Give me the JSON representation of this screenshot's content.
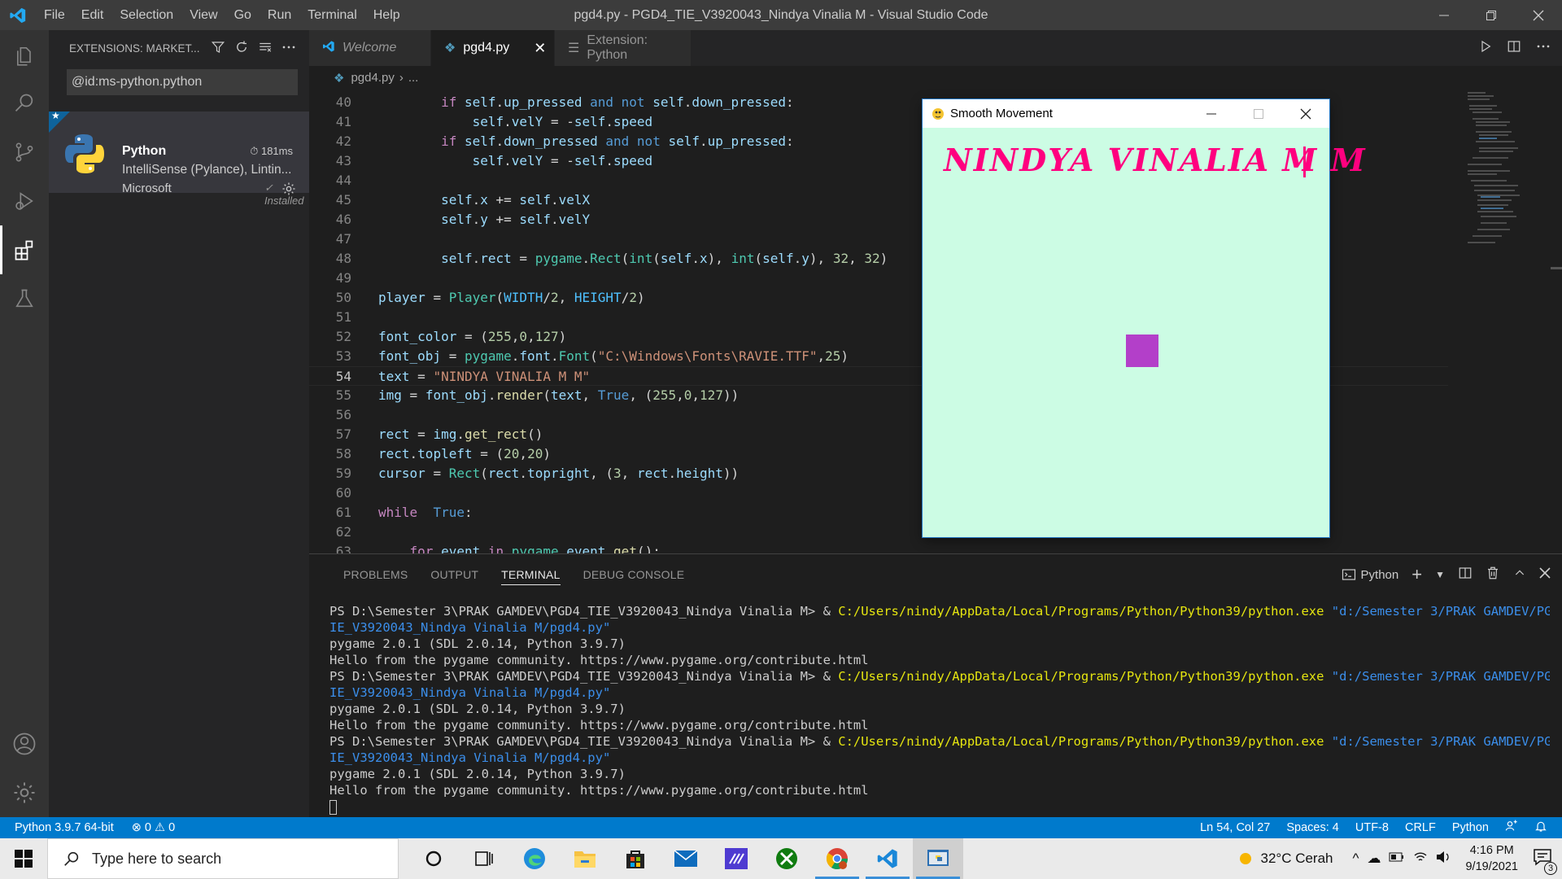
{
  "titlebar": {
    "menu": [
      "File",
      "Edit",
      "Selection",
      "View",
      "Go",
      "Run",
      "Terminal",
      "Help"
    ],
    "title": "pgd4.py - PGD4_TIE_V3920043_Nindya Vinalia M - Visual Studio Code"
  },
  "sidebar": {
    "header": "EXTENSIONS: MARKET...",
    "search_value": "@id:ms-python.python",
    "extension": {
      "name": "Python",
      "time": "181ms",
      "description": "IntelliSense (Pylance), Lintin...",
      "publisher": "Microsoft",
      "status": "Installed"
    }
  },
  "tabs": [
    {
      "label": "Welcome",
      "icon": "vscode-logo-icon"
    },
    {
      "label": "pgd4.py",
      "icon": "python-file-icon"
    },
    {
      "label": "Extension: Python",
      "icon": "preview-icon"
    }
  ],
  "breadcrumb": {
    "file": "pgd4.py",
    "sep": "›",
    "rest": "..."
  },
  "editor": {
    "current_line": 54,
    "line_numbers": [
      40,
      41,
      42,
      43,
      44,
      45,
      46,
      47,
      48,
      49,
      50,
      51,
      52,
      53,
      54,
      55,
      56,
      57,
      58,
      59,
      60,
      61,
      62,
      63
    ]
  },
  "pygame_window": {
    "title": "Smooth Movement",
    "text": "NINDYA VINALIA M M",
    "text_color": "#ff007f",
    "background": "#ccfce4",
    "player_color": "#b33fc9"
  },
  "panel": {
    "tabs": [
      "PROBLEMS",
      "OUTPUT",
      "TERMINAL",
      "DEBUG CONSOLE"
    ],
    "active_tab": "TERMINAL",
    "shell": "Python",
    "terminal": {
      "prompt": "PS D:\\Semester 3\\PRAK GAMDEV\\PGD4_TIE_V3920043_Nindya Vinalia M> & ",
      "exe": "C:/Users/nindy/AppData/Local/Programs/Python/Python39/python.exe",
      "arg1": " \"d:/Semester 3/PRAK GAMDEV/PGD4_T",
      "arg2": "IE_V3920043_Nindya Vinalia M/pgd4.py\"",
      "pygame": "pygame 2.0.1 (SDL 2.0.14, Python 3.9.7)",
      "hello": "Hello from the pygame community. https://www.pygame.org/contribute.html"
    }
  },
  "statusbar": {
    "interpreter": "Python 3.9.7 64-bit",
    "errors": "0",
    "warnings": "0",
    "position": "Ln 54, Col 27",
    "spaces": "Spaces: 4",
    "encoding": "UTF-8",
    "eol": "CRLF",
    "language": "Python"
  },
  "taskbar": {
    "search_placeholder": "Type here to search",
    "weather": "32°C  Cerah",
    "time": "4:16 PM",
    "date": "9/19/2021",
    "notifications": "3"
  }
}
